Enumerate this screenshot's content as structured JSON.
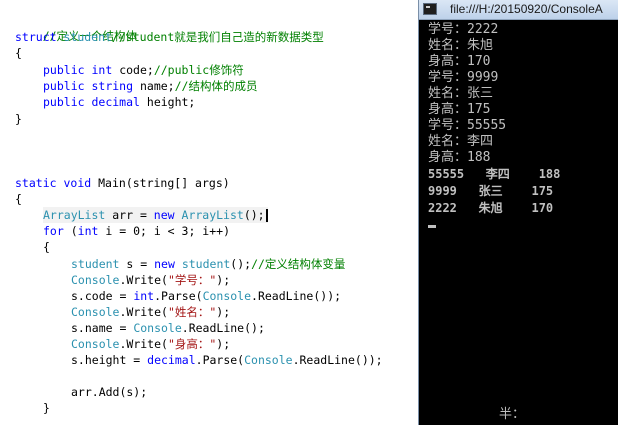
{
  "editor": {
    "lines": {
      "l1": {
        "comment": "//定义一个结构体"
      },
      "l2": {
        "kw": "struct",
        "name": "student",
        "comment": "//student就是我们自己造的新数据类型"
      },
      "l3": {
        "text": "{"
      },
      "l4": {
        "kw1": "public",
        "kw2": "int",
        "text": "code;",
        "comment": "//public修饰符"
      },
      "l5": {
        "kw1": "public",
        "kw2": "string",
        "text": "name;",
        "comment": "//结构体的成员"
      },
      "l6": {
        "kw1": "public",
        "kw2": "decimal",
        "text": "height;"
      },
      "l7": {
        "text": "}"
      },
      "l8": {
        "kw1": "static",
        "kw2": "void",
        "text": "Main(string[] args)"
      },
      "l9": {
        "text": "{"
      },
      "l10": {
        "type1": "ArrayList",
        "text1": "arr = ",
        "kw": "new",
        "type2": "ArrayList",
        "text2": "();"
      },
      "l11": {
        "kw1": "for",
        "text1": "(",
        "kw2": "int",
        "text2": "i = 0; i < 3; i++)"
      },
      "l12": {
        "text": "{"
      },
      "l13": {
        "type1": "student",
        "text1": "s = ",
        "kw": "new",
        "type2": "student",
        "text2": "();",
        "comment": "//定义结构体变量"
      },
      "l14": {
        "type": "Console",
        "text1": ".Write(",
        "str": "\"学号：\"",
        "text2": ");"
      },
      "l15": {
        "text1": "s.code = ",
        "kw": "int",
        "text2": ".Parse(",
        "type": "Console",
        "text3": ".ReadLine());"
      },
      "l16": {
        "type": "Console",
        "text1": ".Write(",
        "str": "\"姓名：\"",
        "text2": ");"
      },
      "l17": {
        "text1": "s.name = ",
        "type": "Console",
        "text2": ".ReadLine();"
      },
      "l18": {
        "type": "Console",
        "text1": ".Write(",
        "str": "\"身高：\"",
        "text2": ");"
      },
      "l19": {
        "text1": "s.height = ",
        "kw": "decimal",
        "text2": ".Parse(",
        "type": "Console",
        "text3": ".ReadLine());"
      },
      "l20": {
        "text": "arr.Add(s);"
      },
      "l21": {
        "text": "}"
      }
    }
  },
  "console": {
    "title": "file:///H:/20150920/ConsoleA",
    "output": [
      "学号：2222",
      "姓名：朱旭",
      "身高：170",
      "学号：9999",
      "姓名：张三",
      "身高：175",
      "学号：55555",
      "姓名：李四",
      "身高：188"
    ],
    "table": [
      "55555   李四    188",
      "9999   张三    175",
      "2222   朱旭    170"
    ],
    "status": "半："
  }
}
